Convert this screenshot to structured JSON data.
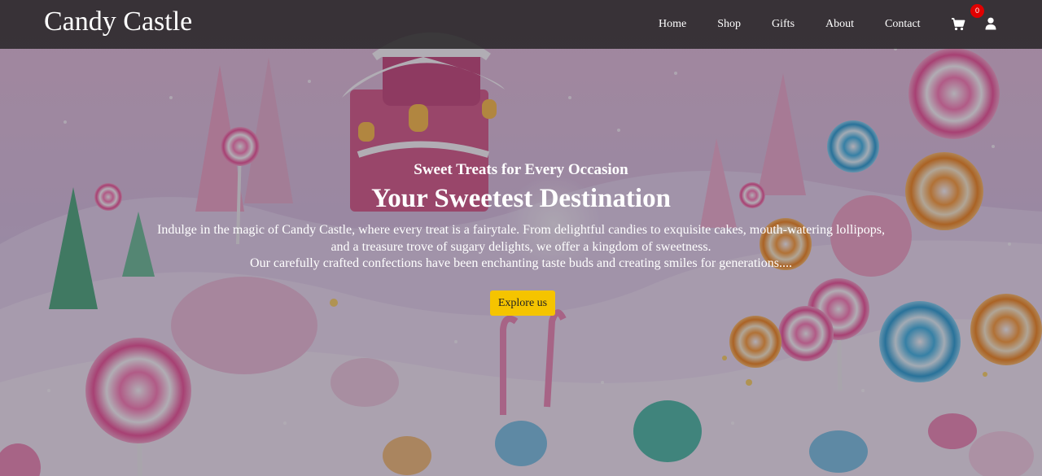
{
  "brand": {
    "name": "Candy Castle"
  },
  "nav": {
    "links": [
      {
        "label": "Home"
      },
      {
        "label": "Shop"
      },
      {
        "label": "Gifts"
      },
      {
        "label": "About"
      },
      {
        "label": "Contact"
      }
    ],
    "cart": {
      "icon": "cart-icon",
      "count": "0"
    },
    "user": {
      "icon": "user-icon"
    }
  },
  "hero": {
    "kicker": "Sweet Treats for Every Occasion",
    "title": "Your Sweetest Destination",
    "description_lines": [
      "Indulge in the magic of Candy Castle, where every treat is a fairytale. From delightful candies to exquisite cakes, mouth-watering lollipops,",
      "and a treasure trove of sugary delights, we offer a kingdom of sweetness.",
      "Our carefully crafted confections have been enchanting taste buds and creating smiles for generations...."
    ],
    "cta_label": "Explore us"
  },
  "colors": {
    "navbar_bg": "#242224",
    "accent": "#f5c400",
    "badge": "#e00000",
    "text": "#ffffff"
  }
}
